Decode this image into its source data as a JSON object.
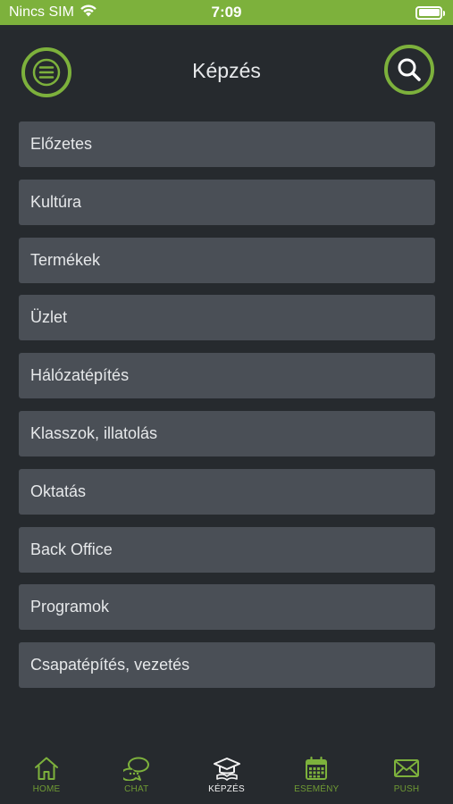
{
  "status_bar": {
    "carrier": "Nincs SIM",
    "time": "7:09",
    "wifi_icon": "wifi-icon",
    "battery_icon": "battery-icon"
  },
  "header": {
    "title": "Képzés",
    "menu_icon": "hamburger-menu-icon",
    "search_icon": "search-icon"
  },
  "list": {
    "items": [
      {
        "label": "Előzetes"
      },
      {
        "label": "Kultúra"
      },
      {
        "label": "Termékek"
      },
      {
        "label": "Üzlet"
      },
      {
        "label": "Hálózatépítés"
      },
      {
        "label": "Klasszok, illatolás"
      },
      {
        "label": "Oktatás"
      },
      {
        "label": "Back Office"
      },
      {
        "label": "Programok"
      },
      {
        "label": "Csapatépítés, vezetés"
      }
    ]
  },
  "tabbar": {
    "tabs": [
      {
        "label": "HOME",
        "icon": "home-icon",
        "active": false
      },
      {
        "label": "CHAT",
        "icon": "chat-icon",
        "active": false
      },
      {
        "label": "KÉPZÉS",
        "icon": "graduation-cap-icon",
        "active": true
      },
      {
        "label": "ESEMÉNY",
        "icon": "calendar-icon",
        "active": false
      },
      {
        "label": "PUSH",
        "icon": "envelope-icon",
        "active": false
      }
    ]
  },
  "colors": {
    "accent": "#7db13c",
    "background": "#262a2e",
    "list_item": "#4a4f56"
  }
}
